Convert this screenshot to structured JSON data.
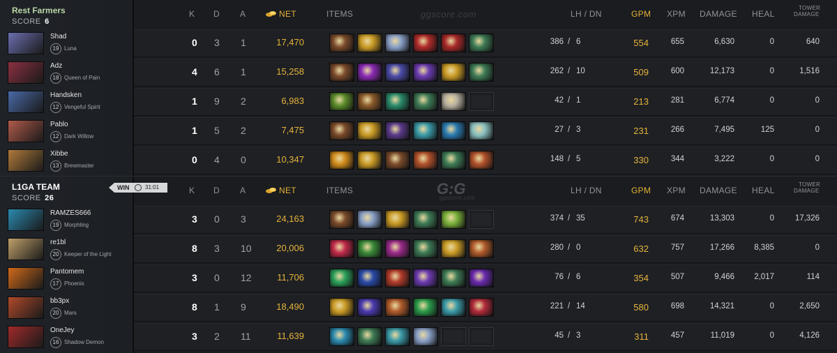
{
  "headers": {
    "k": "K",
    "d": "D",
    "a": "A",
    "net": "NET",
    "items": "ITEMS",
    "lh_dn": "LH / DN",
    "gpm": "GPM",
    "xpm": "XPM",
    "damage": "DAMAGE",
    "heal": "HEAL",
    "tower_damage_1": "TOWER",
    "tower_damage_2": "DAMAGE"
  },
  "watermark": {
    "top": "ggscore.com",
    "logo": "G:G",
    "bottom": "ggscore.com"
  },
  "team1": {
    "name": "Rest Farmers",
    "score_label": "SCORE",
    "score": "6",
    "players": [
      {
        "name": "Shad",
        "level": "19",
        "hero": "Luna",
        "k": "0",
        "d": "3",
        "a": "1",
        "net": "17,470",
        "lh": "386",
        "dn": "6",
        "gpm": "554",
        "xpm": "655",
        "damage": "6,630",
        "heal": "0",
        "tower": "640",
        "avatar_color": "#6b6fb0",
        "items": [
          "#7a4a2a",
          "#c99a25",
          "#8aa0c8",
          "#b02a2a",
          "#a82828",
          "#3d7a55"
        ]
      },
      {
        "name": "Adz",
        "level": "18",
        "hero": "Queen of Pain",
        "k": "4",
        "d": "6",
        "a": "1",
        "net": "15,258",
        "lh": "262",
        "dn": "10",
        "gpm": "509",
        "xpm": "600",
        "damage": "12,173",
        "heal": "0",
        "tower": "1,516",
        "avatar_color": "#8a3040",
        "items": [
          "#7a4a2a",
          "#8a2ab5",
          "#4a4aa8",
          "#6a3ab0",
          "#c99a25",
          "#3d7a55"
        ]
      },
      {
        "name": "Handsken",
        "level": "12",
        "hero": "Vengeful Spirit",
        "k": "1",
        "d": "9",
        "a": "2",
        "net": "6,983",
        "lh": "42",
        "dn": "1",
        "gpm": "213",
        "xpm": "281",
        "damage": "6,774",
        "heal": "0",
        "tower": "0",
        "avatar_color": "#4a6aa8",
        "items": [
          "#5a8a2a",
          "#8a5a2a",
          "#2a8a6a",
          "#3d7a55",
          "#b8b0a0",
          ""
        ]
      },
      {
        "name": "Pablo",
        "level": "12",
        "hero": "Dark Willow",
        "k": "1",
        "d": "5",
        "a": "2",
        "net": "7,475",
        "lh": "27",
        "dn": "3",
        "gpm": "231",
        "xpm": "266",
        "damage": "7,495",
        "heal": "125",
        "tower": "0",
        "avatar_color": "#b05a4a",
        "items": [
          "#7a4a2a",
          "#c99a25",
          "#5a3a8a",
          "#3a9aa8",
          "#2a7ab0",
          "#8ac0c0",
          "#b08a4a"
        ]
      },
      {
        "name": "Xibbe",
        "level": "13",
        "hero": "Brewmaster",
        "k": "0",
        "d": "4",
        "a": "0",
        "net": "10,347",
        "lh": "148",
        "dn": "5",
        "gpm": "330",
        "xpm": "344",
        "damage": "3,222",
        "heal": "0",
        "tower": "0",
        "avatar_color": "#b07a3a",
        "items": [
          "#d08a1a",
          "#c99a25",
          "#7a4a2a",
          "#b0502a",
          "#3d7a55",
          "#b0502a"
        ]
      }
    ]
  },
  "team2": {
    "name": "L1GA TEAM",
    "score_label": "SCORE",
    "score": "26",
    "result": "WIN",
    "duration": "31:01",
    "players": [
      {
        "name": "RAMZES666",
        "level": "19",
        "hero": "Morphling",
        "k": "3",
        "d": "0",
        "a": "3",
        "net": "24,163",
        "lh": "374",
        "dn": "35",
        "gpm": "743",
        "xpm": "674",
        "damage": "13,303",
        "heal": "0",
        "tower": "17,326",
        "avatar_color": "#2a8ab0",
        "items": [
          "#7a4a2a",
          "#8aa0c8",
          "#c99a25",
          "#3d7a55",
          "#7ab03a",
          ""
        ]
      },
      {
        "name": "re1bl",
        "level": "20",
        "hero": "Keeper of the Light",
        "k": "8",
        "d": "3",
        "a": "10",
        "net": "20,006",
        "lh": "280",
        "dn": "0",
        "gpm": "632",
        "xpm": "757",
        "damage": "17,266",
        "heal": "8,385",
        "tower": "0",
        "avatar_color": "#c0a06a",
        "items": [
          "#c02a4a",
          "#3a8a3a",
          "#9a2a8a",
          "#3d7a55",
          "#c99a25",
          "#b05a2a"
        ]
      },
      {
        "name": "Pantomem",
        "level": "17",
        "hero": "Phoenix",
        "k": "3",
        "d": "0",
        "a": "12",
        "net": "11,706",
        "lh": "76",
        "dn": "6",
        "gpm": "354",
        "xpm": "507",
        "damage": "9,466",
        "heal": "2,017",
        "tower": "114",
        "avatar_color": "#d06a1a",
        "items": [
          "#2aa05a",
          "#2a4aa8",
          "#b03a2a",
          "#6a3ab0",
          "#3d7a55",
          "#6a2ab0"
        ]
      },
      {
        "name": "bb3px",
        "level": "20",
        "hero": "Mars",
        "k": "8",
        "d": "1",
        "a": "9",
        "net": "18,490",
        "lh": "221",
        "dn": "14",
        "gpm": "580",
        "xpm": "698",
        "damage": "14,321",
        "heal": "0",
        "tower": "2,650",
        "avatar_color": "#b04a2a",
        "items": [
          "#c99a25",
          "#4a3ab0",
          "#b05a2a",
          "#2a9a4a",
          "#3a9aa8",
          "#b02a3a"
        ]
      },
      {
        "name": "OneJey",
        "level": "16",
        "hero": "Shadow Demon",
        "k": "3",
        "d": "2",
        "a": "11",
        "net": "11,639",
        "lh": "45",
        "dn": "3",
        "gpm": "311",
        "xpm": "457",
        "damage": "11,019",
        "heal": "0",
        "tower": "4,126",
        "avatar_color": "#a02a2a",
        "items": [
          "#2a8ab0",
          "#3d7a55",
          "#3a9aa8",
          "#8aa0c8",
          "",
          ""
        ]
      }
    ]
  }
}
